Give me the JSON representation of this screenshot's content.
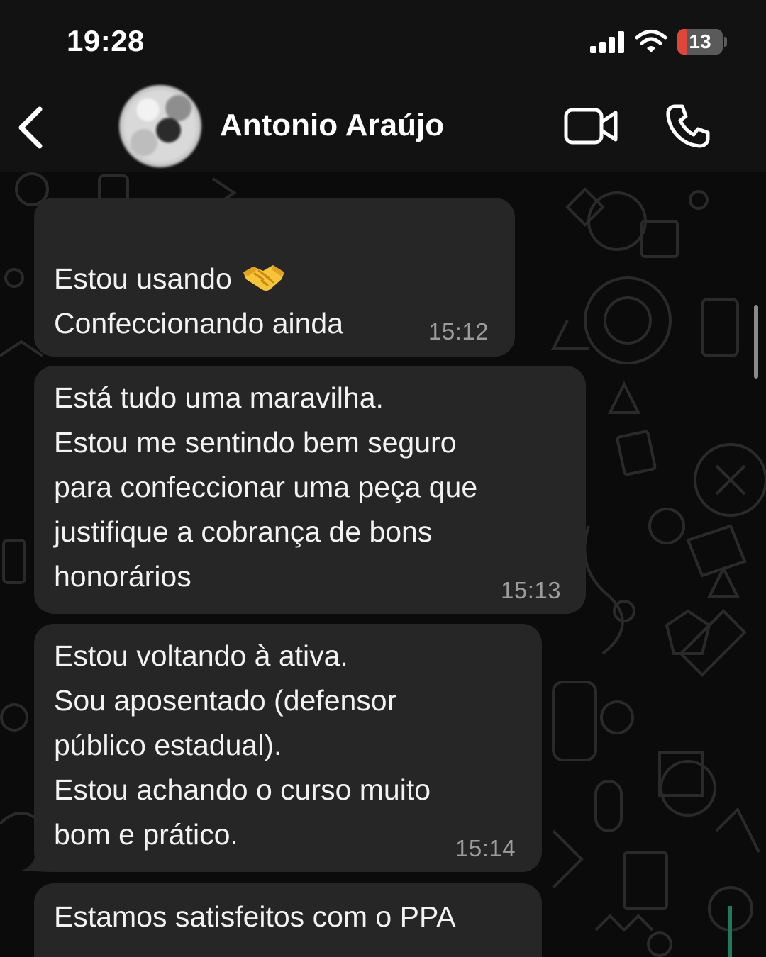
{
  "status_bar": {
    "time": "19:28",
    "battery_level": "13",
    "battery_color": "#e0453a",
    "icons": [
      "signal-icon",
      "wifi-icon",
      "battery-icon"
    ]
  },
  "header": {
    "contact_name": "Antonio Araújo",
    "icons": [
      "back-icon",
      "avatar",
      "video-call-icon",
      "phone-call-icon"
    ]
  },
  "messages": [
    {
      "text": "Estou usando",
      "text2": "Confeccionando ainda",
      "emoji": "handshake-emoji",
      "time": "15:12"
    },
    {
      "text": "Está tudo uma maravilha.\nEstou me sentindo bem seguro\npara confeccionar uma peça que\njustifique a cobrança de bons\nhonorários",
      "time": "15:13"
    },
    {
      "text": "Estou voltando à ativa.\nSou aposentado (defensor\npúblico estadual).\nEstou achando o curso  muito\nbom e prático.",
      "time": "15:14"
    },
    {
      "text": "Estamos satisfeitos com o PPA",
      "time": ""
    }
  ],
  "colors": {
    "bubble_background": "#262626",
    "chat_background": "#0b0b0b",
    "header_background": "#121212",
    "timestamp": "#9c9c9c"
  }
}
